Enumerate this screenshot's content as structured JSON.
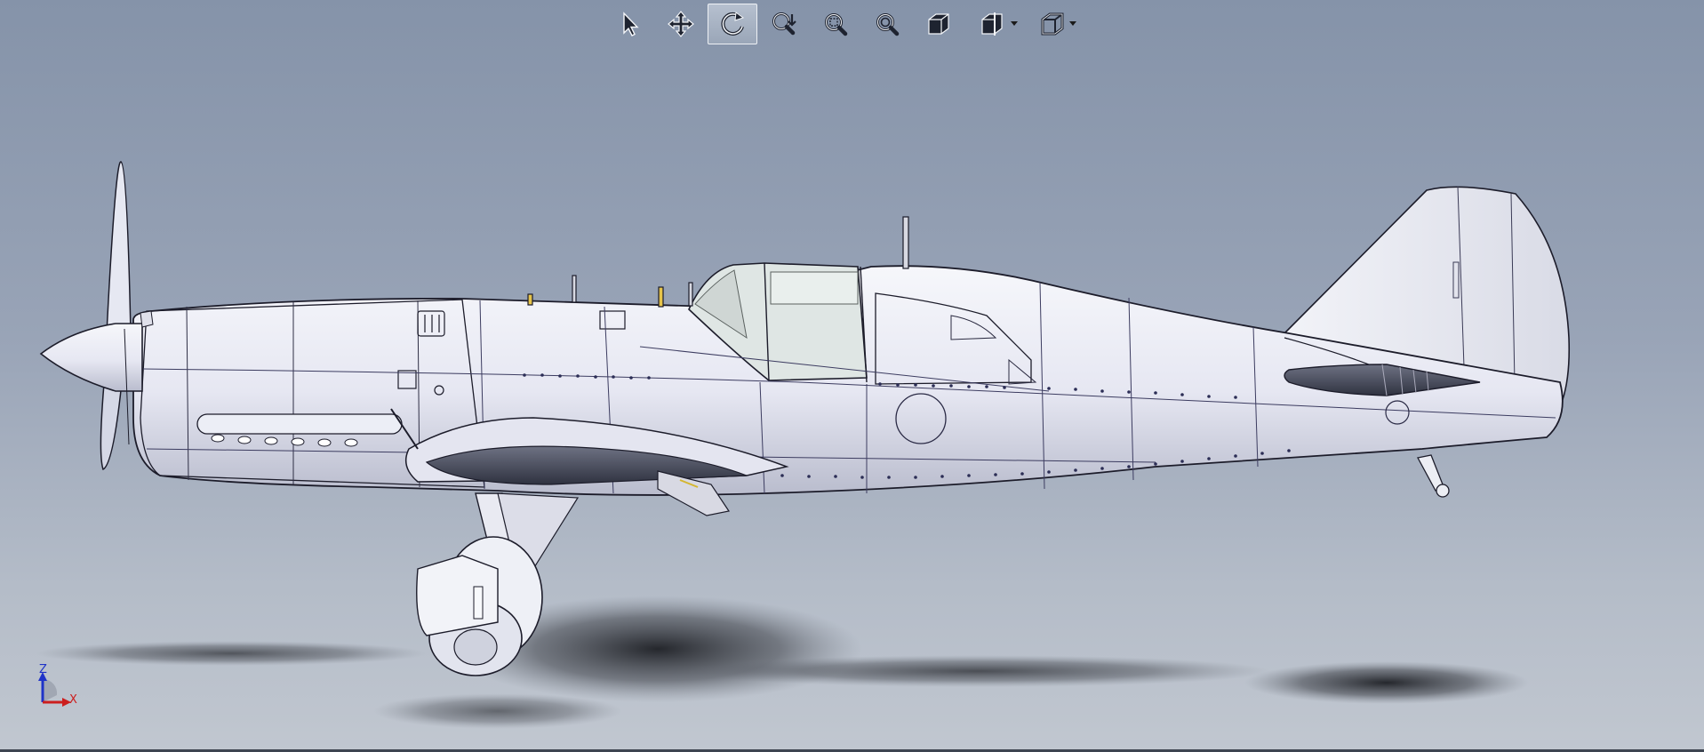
{
  "viewport": {
    "background_top": "#8593a9",
    "background_bottom": "#c1c7d0",
    "model": "aircraft-side-view"
  },
  "toolbar": {
    "items": [
      {
        "icon": "select-arrow-icon",
        "active": false
      },
      {
        "icon": "pan-icon",
        "active": false
      },
      {
        "icon": "rotate-icon",
        "active": true
      },
      {
        "icon": "zoom-to-fit-icon",
        "active": false
      },
      {
        "icon": "zoom-to-area-icon",
        "active": false
      },
      {
        "icon": "zoom-in-out-icon",
        "active": false
      },
      {
        "icon": "view-orientation-icon",
        "active": false
      },
      {
        "icon": "section-view-icon",
        "active": false,
        "dropdown": true
      },
      {
        "icon": "display-style-icon",
        "active": false,
        "dropdown": true
      }
    ]
  },
  "triad": {
    "z_label": "Z",
    "x_label": "X",
    "z_color": "#1f33c8",
    "x_color": "#cc1e1e"
  }
}
